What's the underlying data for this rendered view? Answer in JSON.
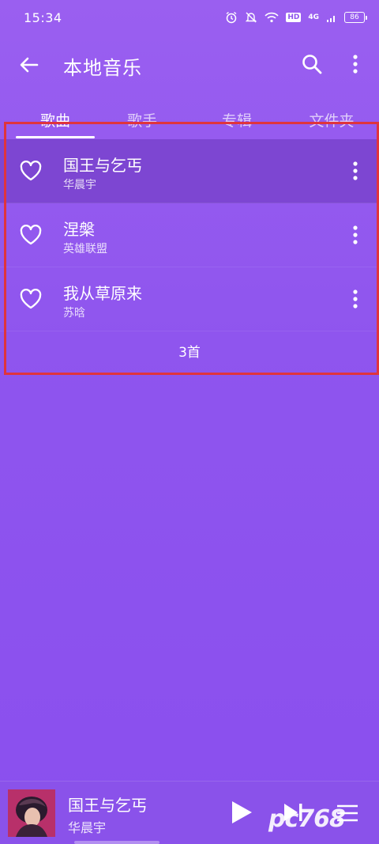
{
  "status_bar": {
    "time": "15:34",
    "hd": "HD",
    "network": "4G",
    "battery": "86"
  },
  "app_bar": {
    "title": "本地音乐",
    "back_icon": "arrow-left-icon",
    "search_icon": "search-icon",
    "more_icon": "more-vertical-icon"
  },
  "tabs": [
    {
      "label": "歌曲",
      "active": true
    },
    {
      "label": "歌手",
      "active": false
    },
    {
      "label": "专辑",
      "active": false
    },
    {
      "label": "文件夹",
      "active": false
    }
  ],
  "songs": [
    {
      "title": "国王与乞丐",
      "artist": "华晨宇",
      "selected": true
    },
    {
      "title": "涅槃",
      "artist": "英雄联盟",
      "selected": false
    },
    {
      "title": "我从草原来",
      "artist": "苏晗",
      "selected": false
    }
  ],
  "song_count": "3首",
  "player": {
    "title": "国王与乞丐",
    "artist": "华晨宇",
    "play_icon": "play-icon",
    "next_icon": "skip-next-icon",
    "queue_icon": "playlist-icon"
  },
  "watermark": "pc768",
  "colors": {
    "background": "#8f55ee",
    "selected_row": "#7d46d2",
    "highlight_box": "#e0343c"
  }
}
